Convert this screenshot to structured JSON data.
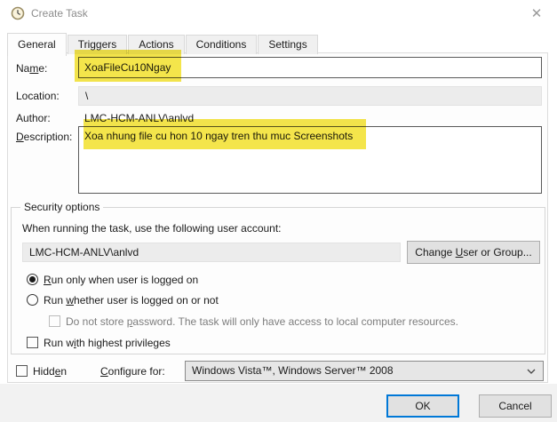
{
  "window": {
    "title": "Create Task",
    "close_glyph": "✕"
  },
  "tabs": [
    {
      "label": "General",
      "active": true
    },
    {
      "label": "Triggers",
      "active": false
    },
    {
      "label": "Actions",
      "active": false
    },
    {
      "label": "Conditions",
      "active": false
    },
    {
      "label": "Settings",
      "active": false
    }
  ],
  "general": {
    "name_label": {
      "pre": "Na",
      "key": "m",
      "post": "e:"
    },
    "name_value": "XoaFileCu10Ngay",
    "location_label": "Location:",
    "location_value": "\\",
    "author_label": "Author:",
    "author_value": "LMC-HCM-ANLV\\anlvd",
    "description_label": {
      "pre": "",
      "key": "D",
      "post": "escription:"
    },
    "description_value": "Xoa nhung file cu hon 10 ngay tren thu muc Screenshots",
    "security": {
      "group_title": "Security options",
      "account_hint": "When running the task, use the following user account:",
      "account_value": "LMC-HCM-ANLV\\anlvd",
      "change_user_button": {
        "pre": "Change ",
        "key": "U",
        "post": "ser or Group..."
      },
      "radio_logged_on": {
        "pre": "",
        "key": "R",
        "post": "un only when user is logged on",
        "checked": true
      },
      "radio_whether": {
        "pre": "Run ",
        "key": "w",
        "post": "hether user is logged on or not",
        "checked": false
      },
      "checkbox_password": {
        "pre": "Do not store ",
        "key": "p",
        "post": "assword.  The task will only have access to local computer resources.",
        "disabled": true
      },
      "checkbox_privileges": {
        "pre": "Run w",
        "key": "i",
        "post": "th highest privileges",
        "checked": false
      }
    },
    "hidden_checkbox": {
      "pre": "Hidd",
      "key": "e",
      "post": "n",
      "checked": false
    },
    "configure_label": {
      "pre": "",
      "key": "C",
      "post": "onfigure for:"
    },
    "configure_value": "Windows Vista™, Windows Server™ 2008"
  },
  "footer": {
    "ok_label": "OK",
    "cancel_label": "Cancel"
  },
  "colors": {
    "highlight_yellow": "#f4e33b",
    "focus_blue": "#0078d7",
    "title_gray": "#8c8c8c"
  }
}
